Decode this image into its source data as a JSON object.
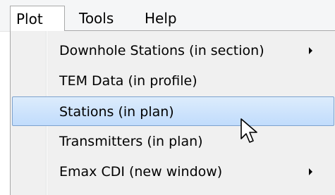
{
  "menubar": {
    "items": [
      {
        "label": "Plot",
        "active": true
      },
      {
        "label": "Tools",
        "active": false
      },
      {
        "label": "Help",
        "active": false
      }
    ]
  },
  "dropdown": {
    "items": [
      {
        "label": "Downhole Stations (in section)",
        "submenu": true,
        "highlighted": false
      },
      {
        "label": "TEM Data (in profile)",
        "submenu": false,
        "highlighted": false
      },
      {
        "label": "Stations (in plan)",
        "submenu": false,
        "highlighted": true
      },
      {
        "label": "Transmitters (in plan)",
        "submenu": false,
        "highlighted": false
      },
      {
        "label": "Emax CDI (new window)",
        "submenu": true,
        "highlighted": false
      }
    ]
  },
  "cursor": {
    "icon": "arrow-pointer-icon"
  },
  "colors": {
    "highlight_border": "#7da2ce",
    "highlight_fill_top": "#dcecfc",
    "highlight_fill_bottom": "#c1dcfc",
    "menu_background": "#f0f0f0"
  }
}
